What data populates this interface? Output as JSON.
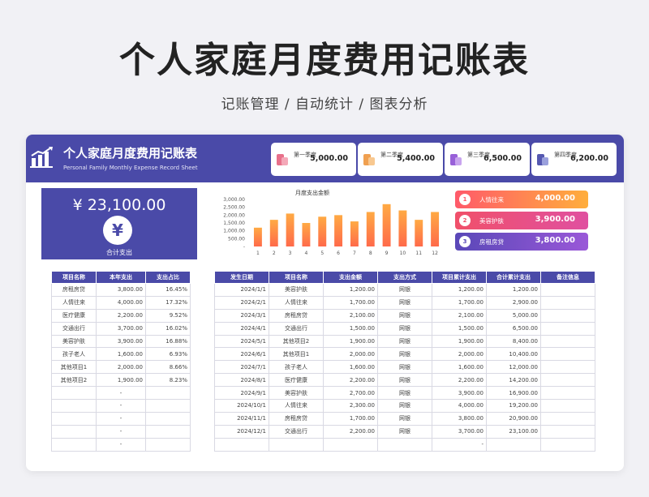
{
  "page": {
    "title": "个人家庭月度费用记账表",
    "subtitle": "记账管理 / 自动统计 / 图表分析"
  },
  "sheet": {
    "title": "个人家庭月度费用记账表",
    "subtitle": "Personal Family Monthly Expense Record Sheet"
  },
  "quarters": [
    {
      "label": "第一季度",
      "value": "5,000.00",
      "color": "#e8708a"
    },
    {
      "label": "第二季度",
      "value": "5,400.00",
      "color": "#f0a050"
    },
    {
      "label": "第三季度",
      "value": "6,500.00",
      "color": "#9860d8"
    },
    {
      "label": "第四季度",
      "value": "6,200.00",
      "color": "#5558b0"
    }
  ],
  "total": {
    "amount": "¥ 23,100.00",
    "symbol": "¥",
    "label": "合计支出"
  },
  "chart_data": {
    "type": "bar",
    "title": "月度支出金额",
    "categories": [
      "1",
      "2",
      "3",
      "4",
      "5",
      "6",
      "7",
      "8",
      "9",
      "10",
      "11",
      "12"
    ],
    "values": [
      1200,
      1700,
      2100,
      1500,
      1900,
      2000,
      1600,
      2200,
      2700,
      2300,
      1700,
      2200
    ],
    "yticks": [
      "3,000.00",
      "2,500.00",
      "2,000.00",
      "1,500.00",
      "1,000.00",
      "500.00",
      "-"
    ],
    "ylim": [
      0,
      3000
    ],
    "grid": false,
    "bar_color_top": "#ffaa44",
    "bar_color_bottom": "#ff6a4a"
  },
  "ranking": [
    {
      "num": "1",
      "name": "人情往来",
      "value": "4,000.00",
      "from": "#ff5a6a",
      "to": "#ffae3c"
    },
    {
      "num": "2",
      "name": "美容护肤",
      "value": "3,900.00",
      "from": "#f0506a",
      "to": "#e050a0"
    },
    {
      "num": "3",
      "name": "房租房贷",
      "value": "3,800.00",
      "from": "#5a48b8",
      "to": "#9a58d8"
    }
  ],
  "summary_table": {
    "headers": [
      "项目名称",
      "本年支出",
      "支出占比"
    ],
    "rows": [
      [
        "房租房贷",
        "3,800.00",
        "16.45%"
      ],
      [
        "人情往来",
        "4,000.00",
        "17.32%"
      ],
      [
        "医疗健康",
        "2,200.00",
        "9.52%"
      ],
      [
        "交通出行",
        "3,700.00",
        "16.02%"
      ],
      [
        "美容护肤",
        "3,900.00",
        "16.88%"
      ],
      [
        "孩子老人",
        "1,600.00",
        "6.93%"
      ],
      [
        "其他项目1",
        "2,000.00",
        "8.66%"
      ],
      [
        "其他项目2",
        "1,900.00",
        "8.23%"
      ],
      [
        "",
        "-",
        ""
      ],
      [
        "",
        "-",
        ""
      ],
      [
        "",
        "-",
        ""
      ],
      [
        "",
        "-",
        ""
      ],
      [
        "",
        "-",
        ""
      ]
    ]
  },
  "record_table": {
    "headers": [
      "发生日期",
      "项目名称",
      "支出金额",
      "支出方式",
      "项目累计支出",
      "合计累计支出",
      "备注信息"
    ],
    "rows": [
      [
        "2024/1/1",
        "美容护肤",
        "1,200.00",
        "网银",
        "1,200.00",
        "1,200.00",
        ""
      ],
      [
        "2024/2/1",
        "人情往来",
        "1,700.00",
        "网银",
        "1,700.00",
        "2,900.00",
        ""
      ],
      [
        "2024/3/1",
        "房租房贷",
        "2,100.00",
        "网银",
        "2,100.00",
        "5,000.00",
        ""
      ],
      [
        "2024/4/1",
        "交通出行",
        "1,500.00",
        "网银",
        "1,500.00",
        "6,500.00",
        ""
      ],
      [
        "2024/5/1",
        "其他项目2",
        "1,900.00",
        "网银",
        "1,900.00",
        "8,400.00",
        ""
      ],
      [
        "2024/6/1",
        "其他项目1",
        "2,000.00",
        "网银",
        "2,000.00",
        "10,400.00",
        ""
      ],
      [
        "2024/7/1",
        "孩子老人",
        "1,600.00",
        "网银",
        "1,600.00",
        "12,000.00",
        ""
      ],
      [
        "2024/8/1",
        "医疗健康",
        "2,200.00",
        "网银",
        "2,200.00",
        "14,200.00",
        ""
      ],
      [
        "2024/9/1",
        "美容护肤",
        "2,700.00",
        "网银",
        "3,900.00",
        "16,900.00",
        ""
      ],
      [
        "2024/10/1",
        "人情往来",
        "2,300.00",
        "网银",
        "4,000.00",
        "19,200.00",
        ""
      ],
      [
        "2024/11/1",
        "房租房贷",
        "1,700.00",
        "网银",
        "3,800.00",
        "20,900.00",
        ""
      ],
      [
        "2024/12/1",
        "交通出行",
        "2,200.00",
        "网银",
        "3,700.00",
        "23,100.00",
        ""
      ],
      [
        "",
        "",
        "",
        "",
        "-",
        "",
        ""
      ]
    ]
  },
  "colors": {
    "brand": "#4a4aa8",
    "background": "#f1f1f5"
  }
}
